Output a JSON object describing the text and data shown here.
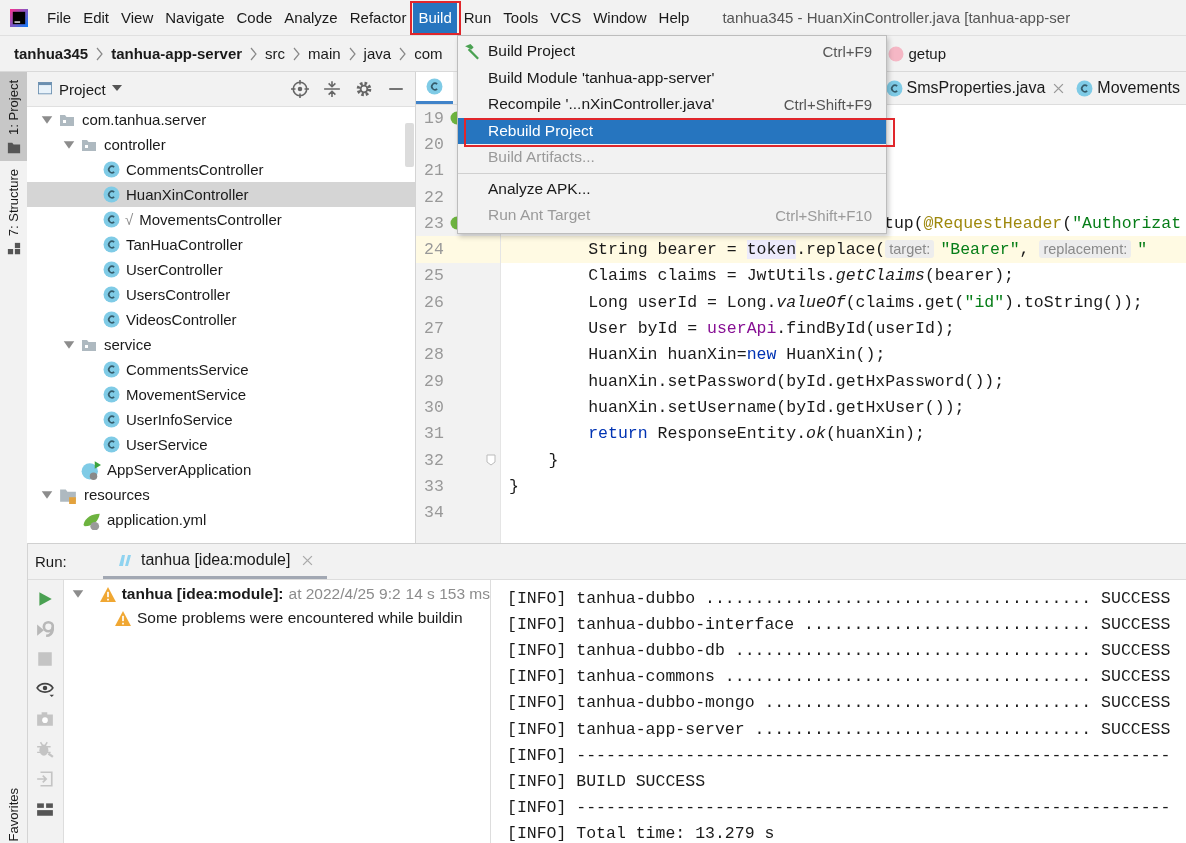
{
  "menu_bar": {
    "items": [
      {
        "label": "File",
        "selected": false,
        "annotated": false
      },
      {
        "label": "Edit",
        "selected": false,
        "annotated": false
      },
      {
        "label": "View",
        "selected": false,
        "annotated": false
      },
      {
        "label": "Navigate",
        "selected": false,
        "annotated": false
      },
      {
        "label": "Code",
        "selected": false,
        "annotated": false
      },
      {
        "label": "Analyze",
        "selected": false,
        "annotated": false
      },
      {
        "label": "Refactor",
        "selected": false,
        "annotated": false
      },
      {
        "label": "Build",
        "selected": true,
        "annotated": true
      },
      {
        "label": "Run",
        "selected": false,
        "annotated": false
      },
      {
        "label": "Tools",
        "selected": false,
        "annotated": false
      },
      {
        "label": "VCS",
        "selected": false,
        "annotated": false
      },
      {
        "label": "Window",
        "selected": false,
        "annotated": false
      },
      {
        "label": "Help",
        "selected": false,
        "annotated": false
      }
    ],
    "window_title": "tanhua345 - HuanXinController.java [tanhua-app-ser"
  },
  "build_menu": [
    {
      "label": "Build Project",
      "shortcut": "Ctrl+F9",
      "kind": "hammer",
      "selected": false,
      "disabled": false,
      "annotated": false
    },
    {
      "label": "Build Module 'tanhua-app-server'",
      "kind": "plain",
      "selected": false,
      "disabled": false,
      "annotated": false
    },
    {
      "label": "Recompile '...nXinController.java'",
      "shortcut": "Ctrl+Shift+F9",
      "kind": "plain",
      "selected": false,
      "disabled": false,
      "annotated": false
    },
    {
      "label": "Rebuild Project",
      "kind": "plain",
      "selected": true,
      "disabled": false,
      "annotated": true
    },
    {
      "label": "Build Artifacts...",
      "kind": "plain",
      "selected": false,
      "disabled": true,
      "annotated": false
    },
    {
      "label": "Analyze APK...",
      "kind": "plain",
      "selected": false,
      "disabled": false,
      "annotated": false,
      "separator_before": true
    },
    {
      "label": "Run Ant Target",
      "shortcut": "Ctrl+Shift+F10",
      "kind": "plain",
      "selected": false,
      "disabled": true,
      "annotated": false
    }
  ],
  "breadcrumbs": [
    {
      "label": "tanhua345",
      "kind": "module"
    },
    {
      "label": "tanhua-app-server",
      "kind": "module"
    },
    {
      "label": "src",
      "kind": "folder"
    },
    {
      "label": "main",
      "kind": "folder"
    },
    {
      "label": "java",
      "kind": "folder"
    },
    {
      "label": "com",
      "kind": "folder"
    },
    {
      "label": "getup",
      "kind": "method"
    }
  ],
  "side_tabs": [
    {
      "label": "1: Project",
      "selected": true,
      "kind": "project"
    },
    {
      "label": "7: Structure",
      "selected": false,
      "kind": "structure"
    },
    {
      "label": "Favorites",
      "selected": false,
      "kind": "favorites"
    }
  ],
  "project_panel": {
    "title": "Project",
    "tree": [
      {
        "label": "com.tanhua.server",
        "kind": "package",
        "expanded": true,
        "selected": false,
        "children": [
          {
            "label": "controller",
            "kind": "folder",
            "expanded": true,
            "selected": false,
            "children": [
              {
                "label": "CommentsController",
                "kind": "class",
                "selected": false
              },
              {
                "label": "HuanXinController",
                "kind": "class",
                "selected": true
              },
              {
                "label": "MovementsController",
                "kind": "class",
                "selected": false,
                "prefix": "√"
              },
              {
                "label": "TanHuaController",
                "kind": "class",
                "selected": false
              },
              {
                "label": "UserController",
                "kind": "class",
                "selected": false
              },
              {
                "label": "UsersController",
                "kind": "class",
                "selected": false
              },
              {
                "label": "VideosController",
                "kind": "class",
                "selected": false
              }
            ]
          },
          {
            "label": "service",
            "kind": "folder",
            "expanded": true,
            "selected": false,
            "children": [
              {
                "label": "CommentsService",
                "kind": "class",
                "selected": false
              },
              {
                "label": "MovementService",
                "kind": "class",
                "selected": false
              },
              {
                "label": "UserInfoService",
                "kind": "class",
                "selected": false
              },
              {
                "label": "UserService",
                "kind": "class",
                "selected": false
              }
            ]
          },
          {
            "label": "AppServerApplication",
            "kind": "app",
            "selected": false
          }
        ]
      },
      {
        "label": "resources",
        "kind": "resources",
        "expanded": true,
        "selected": false,
        "children": [
          {
            "label": "application.yml",
            "kind": "yaml",
            "selected": false
          }
        ]
      }
    ]
  },
  "editor": {
    "tabs": [
      {
        "selected": true,
        "closable": false
      },
      {
        "label": "SmsProperties.java",
        "selected": false,
        "closable": true
      },
      {
        "label": "Movements",
        "selected": false,
        "closable": false
      }
    ],
    "lines": [
      {
        "number": "19",
        "implements": true,
        "kind": "covered"
      },
      {
        "number": "20",
        "kind": "covered"
      },
      {
        "number": "21",
        "kind": "covered"
      },
      {
        "number": "22",
        "kind": "covered"
      },
      {
        "number": "23",
        "implements": true,
        "kind": "partial",
        "segments": [
          {
            "kind": "plain",
            "text": "tup("
          },
          {
            "kind": "annotation",
            "text": "@RequestHeader"
          },
          {
            "kind": "plain",
            "text": "("
          },
          {
            "kind": "string",
            "text": "\"Authorizat"
          }
        ]
      },
      {
        "number": "24",
        "kind": "current",
        "segments": [
          {
            "kind": "plain",
            "text": "        String bearer = "
          },
          {
            "kind": "usage",
            "text": "token"
          },
          {
            "kind": "plain",
            "text": ".replace("
          },
          {
            "kind": "hint",
            "text": "target:"
          },
          {
            "kind": "string",
            "text": "\"Bearer\""
          },
          {
            "kind": "plain",
            "text": ", "
          },
          {
            "kind": "hint",
            "text": "replacement:"
          },
          {
            "kind": "string",
            "text": "\""
          }
        ]
      },
      {
        "number": "25",
        "kind": "normal",
        "segments": [
          {
            "kind": "plain",
            "text": "        Claims claims = JwtUtils."
          },
          {
            "kind": "italic",
            "text": "getClaims"
          },
          {
            "kind": "plain",
            "text": "(bearer);"
          }
        ]
      },
      {
        "number": "26",
        "kind": "normal",
        "segments": [
          {
            "kind": "plain",
            "text": "        Long userId = Long."
          },
          {
            "kind": "italic",
            "text": "valueOf"
          },
          {
            "kind": "plain",
            "text": "(claims.get("
          },
          {
            "kind": "string",
            "text": "\"id\""
          },
          {
            "kind": "plain",
            "text": ").toString());"
          }
        ]
      },
      {
        "number": "27",
        "kind": "normal",
        "segments": [
          {
            "kind": "plain",
            "text": "        User byId = "
          },
          {
            "kind": "field",
            "text": "userApi"
          },
          {
            "kind": "plain",
            "text": ".findById(userId);"
          }
        ]
      },
      {
        "number": "28",
        "kind": "normal",
        "segments": [
          {
            "kind": "plain",
            "text": "        HuanXin huanXin="
          },
          {
            "kind": "keyword",
            "text": "new"
          },
          {
            "kind": "plain",
            "text": " HuanXin();"
          }
        ]
      },
      {
        "number": "29",
        "kind": "normal",
        "segments": [
          {
            "kind": "plain",
            "text": "        huanXin.setPassword(byId.getHxPassword());"
          }
        ]
      },
      {
        "number": "30",
        "kind": "normal",
        "segments": [
          {
            "kind": "plain",
            "text": "        huanXin.setUsername(byId.getHxUser());"
          }
        ]
      },
      {
        "number": "31",
        "kind": "normal",
        "segments": [
          {
            "kind": "keyword",
            "text": "        return"
          },
          {
            "kind": "plain",
            "text": " ResponseEntity."
          },
          {
            "kind": "italic",
            "text": "ok"
          },
          {
            "kind": "plain",
            "text": "(huanXin);"
          }
        ]
      },
      {
        "number": "32",
        "fold_marker": true,
        "kind": "normal",
        "segments": [
          {
            "kind": "plain",
            "text": "    }"
          }
        ]
      },
      {
        "number": "33",
        "kind": "normal",
        "segments": [
          {
            "kind": "plain",
            "text": "}"
          }
        ]
      },
      {
        "number": "34",
        "kind": "normal"
      }
    ]
  },
  "run_panel": {
    "label": "Run:",
    "tab": {
      "label": "tanhua [idea:module]",
      "selected": true
    },
    "tree": [
      {
        "label": "tanhua [idea:module]:",
        "time": "at 2022/4/25 9:2",
        "duration": "14 s 153 ms",
        "warning": true,
        "expanded": true,
        "children": [
          {
            "label": "Some problems were encountered while buildin",
            "warning": true
          }
        ]
      }
    ],
    "console": [
      "[INFO] tanhua-dubbo ....................................... SUCCESS",
      "[INFO] tanhua-dubbo-interface ............................. SUCCESS",
      "[INFO] tanhua-dubbo-db .................................... SUCCESS",
      "[INFO] tanhua-commons ..................................... SUCCESS",
      "[INFO] tanhua-dubbo-mongo ................................. SUCCESS",
      "[INFO] tanhua-app-server .................................. SUCCESS",
      "[INFO] ------------------------------------------------------------",
      "[INFO] BUILD SUCCESS",
      "[INFO] ------------------------------------------------------------",
      "[INFO] Total time: 13.279 s"
    ]
  }
}
